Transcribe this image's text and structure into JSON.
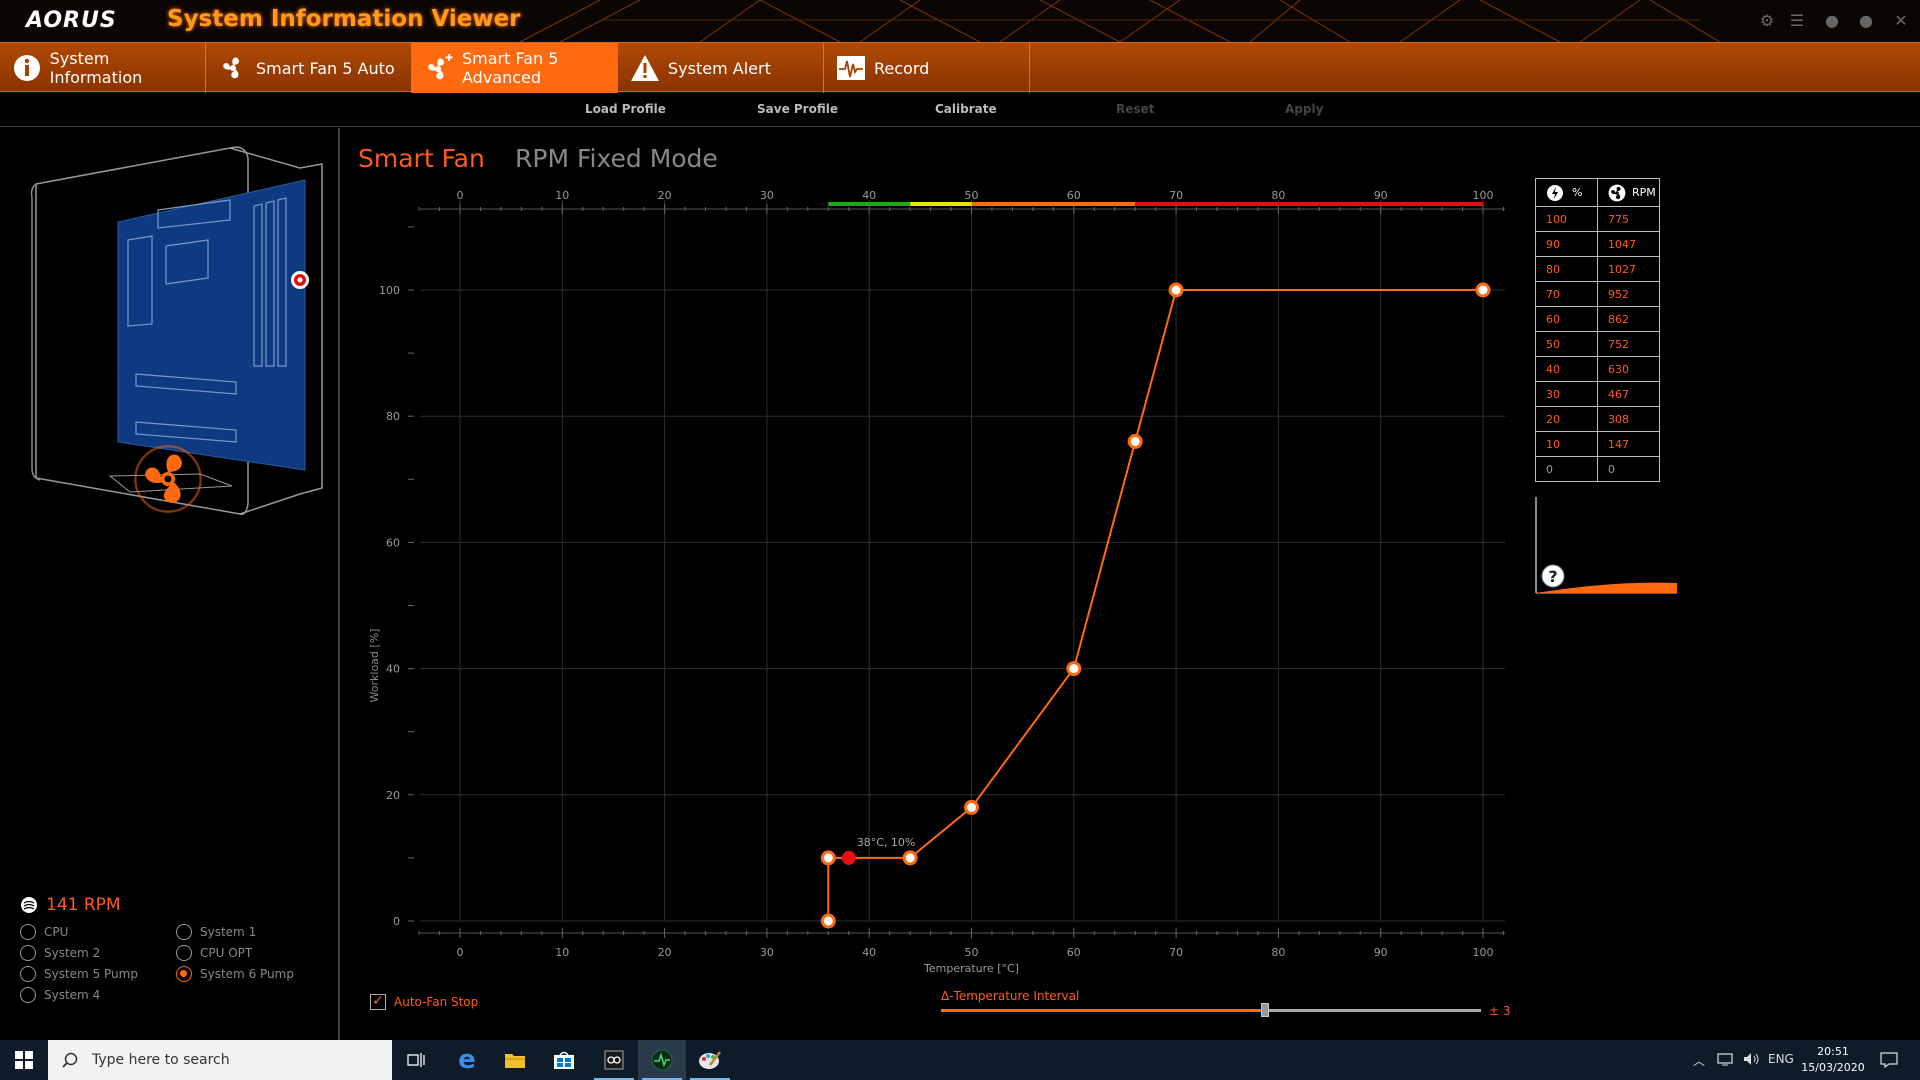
{
  "app": {
    "logo": "AORUS",
    "title": "System Information Viewer"
  },
  "tabs": [
    {
      "label": "System Information",
      "icon": "info-icon"
    },
    {
      "label": "Smart Fan 5 Auto",
      "icon": "fan-icon"
    },
    {
      "label": "Smart Fan 5 Advanced",
      "icon": "fan-plus-icon",
      "active": true
    },
    {
      "label": "System Alert",
      "icon": "alert-icon"
    },
    {
      "label": "Record",
      "icon": "waveform-icon"
    }
  ],
  "subbar": {
    "load": "Load Profile",
    "save": "Save Profile",
    "calibrate": "Calibrate",
    "reset": "Reset",
    "apply": "Apply"
  },
  "fan_status": {
    "rpm": "141 RPM",
    "options": [
      {
        "label": "CPU",
        "selected": false
      },
      {
        "label": "System 1",
        "selected": false
      },
      {
        "label": "System 2",
        "selected": false
      },
      {
        "label": "CPU OPT",
        "selected": false
      },
      {
        "label": "System 5 Pump",
        "selected": false
      },
      {
        "label": "System 6 Pump",
        "selected": true
      },
      {
        "label": "System 4",
        "selected": false
      }
    ]
  },
  "modes": {
    "smart": "Smart Fan",
    "rpm": "RPM Fixed Mode"
  },
  "chart_data": {
    "type": "line",
    "xlabel": "Temperature [°C]",
    "ylabel": "Workload [%]",
    "xlim": [
      0,
      100
    ],
    "ylim": [
      0,
      100
    ],
    "x_ticks": [
      0,
      10,
      20,
      30,
      40,
      50,
      60,
      70,
      80,
      90,
      100
    ],
    "y_ticks": [
      0,
      20,
      40,
      60,
      80,
      100
    ],
    "grid": true,
    "series": [
      {
        "x": [
          36,
          36,
          44,
          50,
          60,
          66,
          70,
          100
        ],
        "y": [
          0,
          10,
          10,
          18,
          40,
          76,
          100,
          100
        ]
      }
    ],
    "current_point": {
      "x": 38,
      "y": 10,
      "label": "38°C, 10%"
    },
    "temperature_bands": [
      {
        "from": 36,
        "to": 44,
        "color": "#1fa81f"
      },
      {
        "from": 44,
        "to": 50,
        "color": "#e6e600"
      },
      {
        "from": 50,
        "to": 66,
        "color": "#ff6a10"
      },
      {
        "from": 66,
        "to": 100,
        "color": "#e01010"
      }
    ]
  },
  "controls": {
    "auto_fan_stop": "Auto-Fan Stop",
    "auto_fan_stop_checked": true,
    "temp_interval_label": "Δ-Temperature Interval",
    "temp_interval_value": "± 3",
    "temp_interval_fraction": 0.6
  },
  "rpm_table": {
    "headers": [
      "%",
      "RPM"
    ],
    "rows": [
      [
        "100",
        "775"
      ],
      [
        "90",
        "1047"
      ],
      [
        "80",
        "1027"
      ],
      [
        "70",
        "952"
      ],
      [
        "60",
        "862"
      ],
      [
        "50",
        "752"
      ],
      [
        "40",
        "630"
      ],
      [
        "30",
        "467"
      ],
      [
        "20",
        "308"
      ],
      [
        "10",
        "147"
      ],
      [
        "0",
        "0"
      ]
    ]
  },
  "taskbar": {
    "search_placeholder": "Type here to search",
    "language": "ENG",
    "time": "20:51",
    "date": "15/03/2020"
  },
  "colors": {
    "accent": "#ff6a10",
    "tab_bar": "#9a3c02"
  }
}
